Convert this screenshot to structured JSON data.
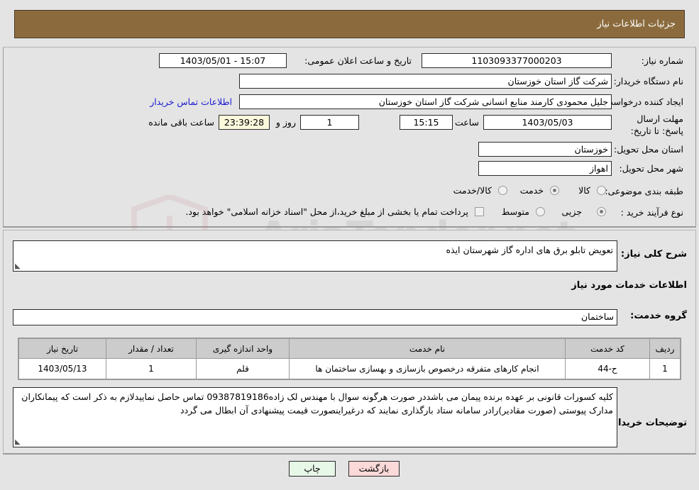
{
  "header": {
    "title": "جزئیات اطلاعات نیاز"
  },
  "watermark": {
    "text": "AriaTender.net",
    "shield": "shield-logo"
  },
  "summary": {
    "need_number_label": "شماره نیاز:",
    "need_number_value": "1103093377000203",
    "announce_datetime_label": "تاریخ و ساعت اعلان عمومی:",
    "announce_datetime_value": "15:07 - 1403/05/01",
    "buyer_org_label": "نام دستگاه خریدار:",
    "buyer_org_value": "شرکت گاز استان خوزستان",
    "requester_label": "ایجاد کننده درخواست:",
    "requester_value": "جلیل محمودی کارمند منابع انسانی شرکت گاز استان خوزستان",
    "contact_link": "اطلاعات تماس خریدار",
    "deadline_label": "مهلت ارسال پاسخ: تا تاریخ:",
    "deadline_date": "1403/05/03",
    "deadline_hour_label": "ساعت",
    "deadline_time": "15:15",
    "remaining_days": "1",
    "remaining_days_label": "روز و",
    "remaining_clock": "23:39:28",
    "remaining_suffix": "ساعت باقی مانده",
    "province_label": "استان محل تحویل:",
    "province_value": "خوزستان",
    "city_label": "شهر محل تحویل:",
    "city_value": "اهواز",
    "category_label": "طبقه بندی موضوعی:",
    "category_options": [
      {
        "label": "کالا",
        "selected": false
      },
      {
        "label": "خدمت",
        "selected": true
      },
      {
        "label": "کالا/خدمت",
        "selected": false
      }
    ],
    "process_label": "نوع فرآیند خرید :",
    "process_options": [
      {
        "label": "جزیی",
        "selected": true
      },
      {
        "label": "متوسط",
        "selected": false
      }
    ],
    "treasury_checkbox_label": "پرداخت تمام یا بخشی از مبلغ خرید،از محل \"اسناد خزانه اسلامی\" خواهد بود.",
    "treasury_checked": false
  },
  "details": {
    "need_desc_label": "شرح کلی نیاز:",
    "need_desc_value": "تعویض تابلو برق های اداره گاز شهرستان ایذه",
    "services_heading": "اطلاعات خدمات مورد نیاز",
    "service_group_label": "گروه خدمت:",
    "service_group_value": "ساختمان",
    "table": {
      "columns": [
        "ردیف",
        "کد خدمت",
        "نام خدمت",
        "واحد اندازه گیری",
        "تعداد / مقدار",
        "تاریخ نیاز"
      ],
      "rows": [
        {
          "row": "1",
          "code": "ح-44",
          "name": "انجام کارهای متفرقه درخصوص بازسازی و بهسازی ساختمان ها",
          "unit": "قلم",
          "qty": "1",
          "date": "1403/05/13"
        }
      ]
    },
    "buyer_notes_label": "توضیحات خریدار:",
    "buyer_notes_value": "کلیه کسورات قانونی بر عهده برنده پیمان می باشددر صورت هرگونه سوال با مهندس لک زاده09387819186 تماس حاصل نماییدلازم به ذکر است که پیمانکاران مدارک پیوستی (صورت مقادیر)رادر سامانه ستاد بارگذاری نمایند که درغیراینصورت قیمت پیشنهادی آن ابطال می گردد"
  },
  "footer": {
    "print_label": "چاپ",
    "back_label": "بازگشت"
  }
}
